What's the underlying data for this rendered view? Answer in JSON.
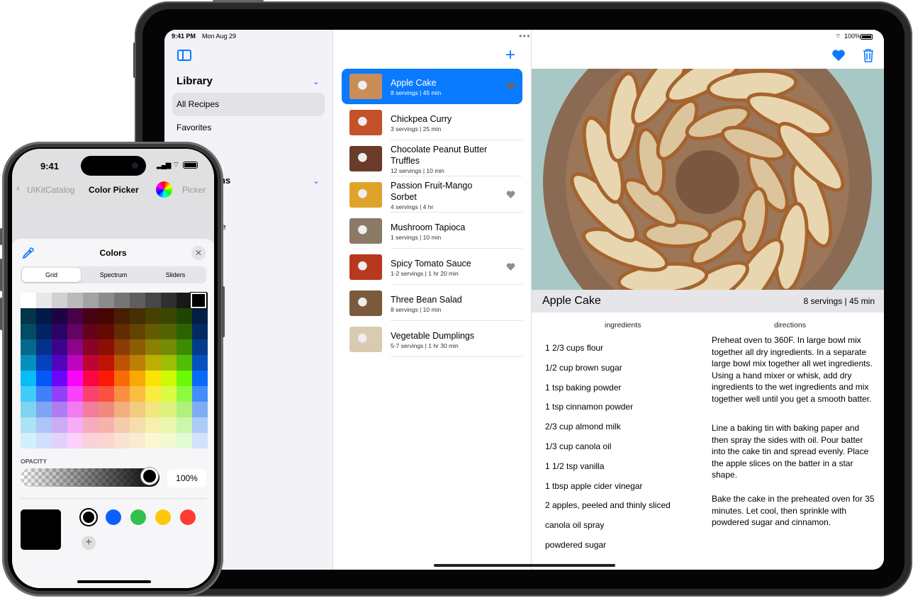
{
  "ipad": {
    "status": {
      "time": "9:41 PM",
      "date": "Mon Aug 29",
      "battery": "100%"
    },
    "sidebar": {
      "library_title": "Library",
      "items": [
        {
          "label": "All Recipes",
          "selected": true
        },
        {
          "label": "Favorites",
          "selected": false
        }
      ],
      "second_section_partial": "ns",
      "partial_item": "e"
    },
    "recipes": [
      {
        "name": "Apple Cake",
        "meta": "8 servings | 45 min",
        "favorite": true,
        "selected": true,
        "thumb": "#c98d5a"
      },
      {
        "name": "Chickpea Curry",
        "meta": "3 servings | 25 min",
        "favorite": false,
        "selected": false,
        "thumb": "#c4512a"
      },
      {
        "name": "Chocolate Peanut Butter Truffles",
        "meta": "12 servings | 10 min",
        "favorite": false,
        "selected": false,
        "thumb": "#6b3b2a"
      },
      {
        "name": "Passion Fruit-Mango Sorbet",
        "meta": "4 servings | 4 hr",
        "favorite": true,
        "selected": false,
        "thumb": "#e0a32a"
      },
      {
        "name": "Mushroom Tapioca",
        "meta": "1 servings | 10 min",
        "favorite": false,
        "selected": false,
        "thumb": "#8a7a66"
      },
      {
        "name": "Spicy Tomato Sauce",
        "meta": "1-2 servings | 1 hr 20 min",
        "favorite": true,
        "selected": false,
        "thumb": "#b8381e"
      },
      {
        "name": "Three Bean Salad",
        "meta": "8 servings | 10 min",
        "favorite": false,
        "selected": false,
        "thumb": "#7a5a3a"
      },
      {
        "name": "Vegetable Dumplings",
        "meta": "5-7 servings | 1 hr 30 min",
        "favorite": false,
        "selected": false,
        "thumb": "#d9cbb2"
      }
    ],
    "detail": {
      "title": "Apple Cake",
      "subtitle": "8 servings | 45 min",
      "ingredients_header": "ingredients",
      "directions_header": "directions",
      "ingredients": [
        "1 2/3 cups flour",
        "1/2 cup brown sugar",
        "1 tsp baking powder",
        "1 tsp cinnamon powder",
        "2/3 cup almond milk",
        "1/3 cup canola oil",
        "1 1/2 tsp vanilla",
        "1 tbsp apple cider vinegar",
        "2 apples, peeled and thinly sliced",
        "canola oil spray",
        "powdered sugar"
      ],
      "directions": [
        "Preheat oven to 360F. In large bowl mix together all dry ingredients. In a separate large bowl mix together all wet ingredients. Using a hand mixer or whisk, add dry ingredients to the wet ingredients and mix together well until you get a smooth batter.",
        "Line a baking tin with baking paper and then spray the sides with oil. Pour batter into the cake tin and spread evenly. Place the apple slices on the batter in a star shape.",
        "Bake the cake in the preheated oven for 35 minutes. Let cool, then sprinkle with powdered sugar and cinnamon."
      ]
    },
    "icons": {
      "sidebar_toggle": "sidebar-left-icon",
      "add": "plus-icon",
      "favorite": "heart-fill-icon",
      "delete": "trash-icon"
    },
    "accent": "#0a7aff"
  },
  "iphone": {
    "status": {
      "time": "9:41"
    },
    "nav": {
      "back": "UIKitCatalog",
      "title": "Color Picker",
      "right": "Picker"
    },
    "sheet": {
      "title": "Colors",
      "tabs": [
        {
          "label": "Grid",
          "selected": true
        },
        {
          "label": "Spectrum",
          "selected": false
        },
        {
          "label": "Sliders",
          "selected": false
        }
      ],
      "opacity_label": "OPACITY",
      "opacity_value": "100%",
      "current_color": "#000000",
      "saved_colors": [
        "#000000",
        "#0a60ff",
        "#30c14a",
        "#ffc70a",
        "#ff3b30"
      ]
    }
  }
}
